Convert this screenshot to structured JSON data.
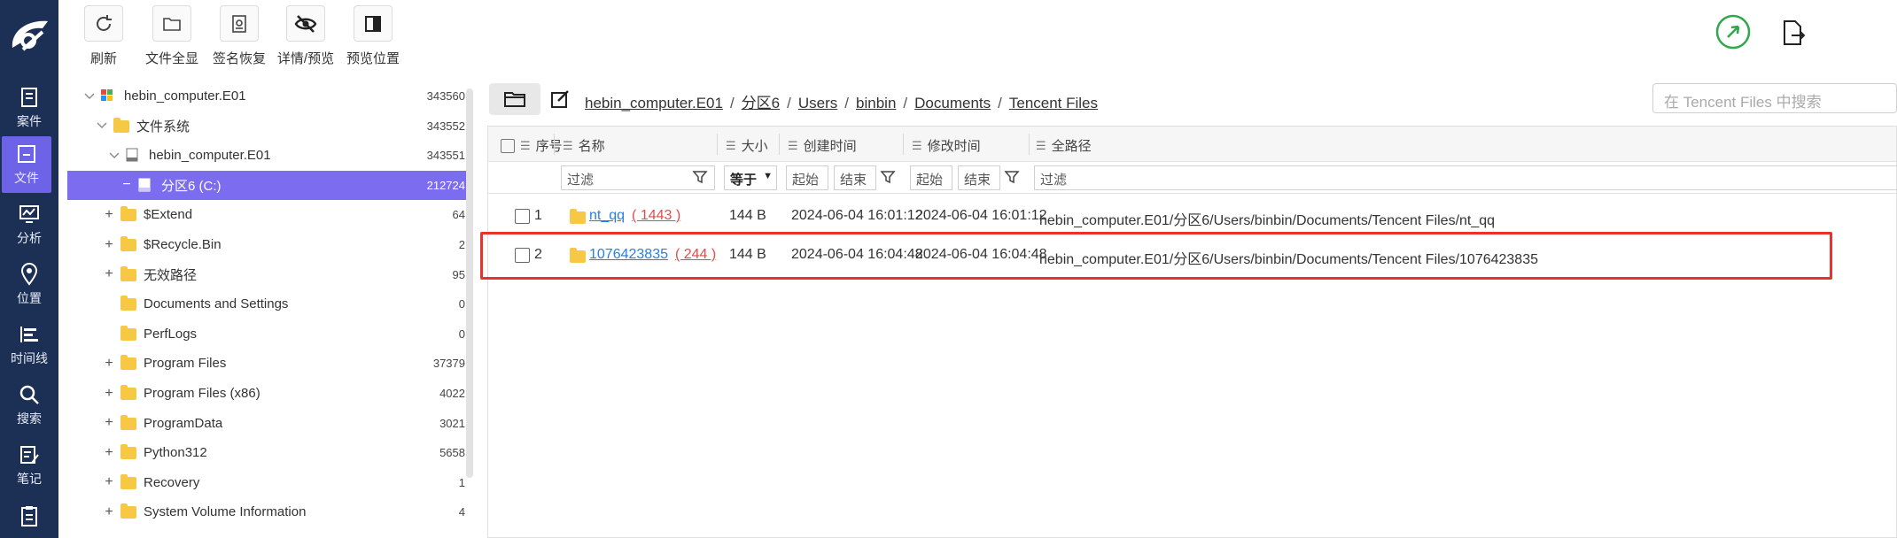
{
  "toolbar": {
    "buttons": [
      {
        "label": "刷新",
        "icon": "refresh-icon"
      },
      {
        "label": "文件全显",
        "icon": "folder-outline-icon"
      },
      {
        "label": "签名恢复",
        "icon": "signature-recover-icon"
      },
      {
        "label": "详情/预览",
        "icon": "eye-off-icon"
      },
      {
        "label": "预览位置",
        "icon": "preview-pane-icon"
      }
    ]
  },
  "nav": {
    "items": [
      {
        "label": "案件",
        "icon": "case-icon"
      },
      {
        "label": "文件",
        "icon": "file-icon",
        "active": true
      },
      {
        "label": "分析",
        "icon": "analysis-icon"
      },
      {
        "label": "位置",
        "icon": "location-icon"
      },
      {
        "label": "时间线",
        "icon": "timeline-icon"
      },
      {
        "label": "搜索",
        "icon": "search-icon"
      },
      {
        "label": "笔记",
        "icon": "notes-icon"
      },
      {
        "label": "",
        "icon": "report-icon"
      }
    ]
  },
  "tree": {
    "rows": [
      {
        "label": "hebin_computer.E01",
        "count": "343560",
        "expander": "v",
        "icon": "windows-icon"
      },
      {
        "label": "文件系统",
        "count": "343552",
        "expander": "v",
        "icon": "folder-icon"
      },
      {
        "label": "hebin_computer.E01",
        "count": "343551",
        "expander": "v",
        "icon": "disk-icon"
      },
      {
        "label": "分区6 (C:)",
        "count": "212724",
        "expander": "−",
        "icon": "drive-icon",
        "selected": true
      },
      {
        "label": "$Extend",
        "count": "64",
        "expander": "+",
        "icon": "folder-icon"
      },
      {
        "label": "$Recycle.Bin",
        "count": "2",
        "expander": "+",
        "icon": "folder-icon"
      },
      {
        "label": "无效路径",
        "count": "95",
        "expander": "+",
        "icon": "folder-icon"
      },
      {
        "label": "Documents and Settings",
        "count": "0",
        "expander": "",
        "icon": "folder-icon"
      },
      {
        "label": "PerfLogs",
        "count": "0",
        "expander": "",
        "icon": "folder-icon"
      },
      {
        "label": "Program Files",
        "count": "37379",
        "expander": "+",
        "icon": "folder-icon"
      },
      {
        "label": "Program Files (x86)",
        "count": "4022",
        "expander": "+",
        "icon": "folder-icon"
      },
      {
        "label": "ProgramData",
        "count": "3021",
        "expander": "+",
        "icon": "folder-icon"
      },
      {
        "label": "Python312",
        "count": "5658",
        "expander": "+",
        "icon": "folder-icon"
      },
      {
        "label": "Recovery",
        "count": "1",
        "expander": "+",
        "icon": "folder-icon"
      },
      {
        "label": "System Volume Information",
        "count": "4",
        "expander": "+",
        "icon": "folder-icon"
      }
    ]
  },
  "breadcrumb": {
    "segments": [
      "hebin_computer.E01",
      "分区6",
      "Users",
      "binbin",
      "Documents",
      "Tencent Files"
    ],
    "separator": "/"
  },
  "search": {
    "placeholder": "在 Tencent Files 中搜索"
  },
  "table": {
    "columns": [
      "序号",
      "名称",
      "大小",
      "创建时间",
      "修改时间",
      "全路径"
    ],
    "filters": {
      "name": "过滤",
      "size_op": "等于",
      "created_start": "起始",
      "created_end": "结束",
      "modified_start": "起始",
      "modified_end": "结束",
      "path": "过滤"
    },
    "rows": [
      {
        "index": "1",
        "name": "nt_qq",
        "count": "( 1443 )",
        "size": "144 B",
        "created": "2024-06-04 16:01:12",
        "modified": "2024-06-04 16:01:12",
        "path": "hebin_computer.E01/分区6/Users/binbin/Documents/Tencent Files/nt_qq"
      },
      {
        "index": "2",
        "name": "1076423835",
        "count": "( 244 )",
        "size": "144 B",
        "created": "2024-06-04 16:04:48",
        "modified": "2024-06-04 16:04:48",
        "path": "hebin_computer.E01/分区6/Users/binbin/Documents/Tencent Files/1076423835",
        "highlighted": true
      }
    ]
  },
  "colors": {
    "nav_bg": "#1c2f55",
    "nav_active": "#6c63e6",
    "tree_selected": "#7b6cf0",
    "link": "#2a7de1",
    "count_red": "#e44a4a",
    "highlight_border": "#e8322e",
    "status_green": "#2ea84a"
  }
}
